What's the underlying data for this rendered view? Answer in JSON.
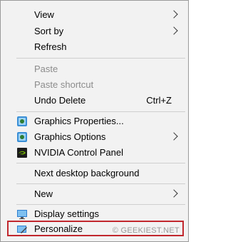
{
  "menu": {
    "view": "View",
    "sort_by": "Sort by",
    "refresh": "Refresh",
    "paste": "Paste",
    "paste_shortcut": "Paste shortcut",
    "undo_delete": "Undo Delete",
    "undo_delete_shortcut": "Ctrl+Z",
    "graphics_properties": "Graphics Properties...",
    "graphics_options": "Graphics Options",
    "nvidia_control_panel": "NVIDIA Control Panel",
    "next_desktop_background": "Next desktop background",
    "new": "New",
    "display_settings": "Display settings",
    "personalize": "Personalize"
  },
  "watermark": "© GEEKIEST.NET",
  "colors": {
    "highlight_border": "#c1272d",
    "menu_bg": "#f2f2f2",
    "disabled_text": "#8c8c8c"
  }
}
